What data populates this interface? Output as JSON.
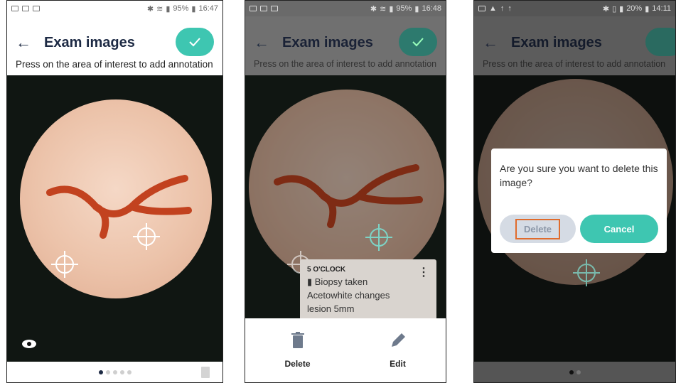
{
  "colors": {
    "accent": "#3ec6b1",
    "title": "#1d2a44",
    "highlight": "#e06b2c"
  },
  "screens": [
    {
      "status": {
        "battery_text": "95%",
        "time": "16:47"
      },
      "title": "Exam images",
      "instruction": "Press on the area of interest to add annotation",
      "back_icon": "arrow-left-icon",
      "confirm_icon": "check-icon",
      "eye_icon": "eye-icon",
      "delete_icon": "trash-icon"
    },
    {
      "status": {
        "battery_text": "95%",
        "time": "16:48"
      },
      "title": "Exam images",
      "instruction": "Press on the area of interest to add annotation",
      "annotation": {
        "position": "5 O'CLOCK",
        "lines": [
          "Biopsy taken",
          "Acetowhite changes",
          "lesion 5mm"
        ]
      },
      "sheet": {
        "delete_label": "Delete",
        "edit_label": "Edit"
      }
    },
    {
      "status": {
        "battery_text": "20%",
        "time": "14:11"
      },
      "title": "Exam images",
      "instruction": "Press on the area of interest to add annotation",
      "dialog": {
        "message": "Are you sure you want to delete this image?",
        "delete_label": "Delete",
        "cancel_label": "Cancel"
      }
    }
  ]
}
